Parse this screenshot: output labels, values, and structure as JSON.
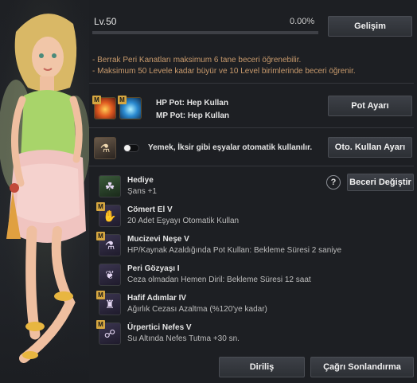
{
  "level": {
    "label": "Lv.50",
    "percent": "0.00%",
    "progress": 0.0
  },
  "buttons": {
    "growth": "Gelişim",
    "pot_settings": "Pot Ayarı",
    "auto_use_settings": "Oto. Kullan Ayarı",
    "change_skill": "Beceri Değiştir",
    "revive": "Diriliş",
    "end_summon": "Çağrı Sonlandırma"
  },
  "notes": [
    "- Berrak Peri Kanatları maksimum 6 tane beceri öğrenebilir.",
    "- Maksimum 50 Levele kadar büyür ve 10 Level birimlerinde beceri öğrenir."
  ],
  "potions": {
    "hp": "HP Pot: Hep Kullan",
    "mp": "MP Pot: Hep Kullan"
  },
  "auto_use": {
    "label": "Yemek, İksir gibi eşyalar otomatik kullanılır.",
    "enabled": false
  },
  "skills": [
    {
      "name": "Hediye",
      "desc": "Şans +1",
      "icon": "clover-icon",
      "glyph": "☘",
      "badge": false
    },
    {
      "name": "Cömert El V",
      "desc": "20 Adet Eşyayı Otomatik Kullan",
      "icon": "hand-sparkle-icon",
      "glyph": "✋",
      "badge": true
    },
    {
      "name": "Mucizevi Neşe V",
      "desc": "HP/Kaynak Azaldığında Pot Kullan: Bekleme Süresi 2 saniye",
      "icon": "potion-plus-icon",
      "glyph": "⚗",
      "badge": true
    },
    {
      "name": "Peri Gözyaşı I",
      "desc": "Ceza olmadan Hemen Diril: Bekleme Süresi 12 saat",
      "icon": "tear-sprout-icon",
      "glyph": "❦",
      "badge": false
    },
    {
      "name": "Hafif Adımlar IV",
      "desc": "Ağırlık Cezası Azaltma (%120'ye kadar)",
      "icon": "weight-bag-icon",
      "glyph": "♜",
      "badge": true
    },
    {
      "name": "Ürpertici Nefes V",
      "desc": "Su Altında Nefes Tutma +30 sn.",
      "icon": "breath-icon",
      "glyph": "☍",
      "badge": true
    }
  ],
  "badge_letter": "M",
  "help_glyph": "?"
}
